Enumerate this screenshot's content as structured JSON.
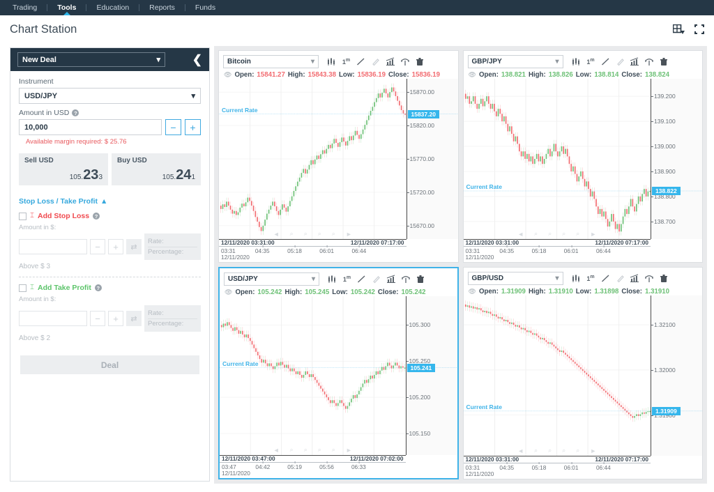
{
  "topnav": {
    "items": [
      {
        "label": "Trading",
        "active": false
      },
      {
        "label": "Tools",
        "active": true
      },
      {
        "label": "Education",
        "active": false
      },
      {
        "label": "Reports",
        "active": false
      },
      {
        "label": "Funds",
        "active": false
      }
    ]
  },
  "header": {
    "title": "Chart Station",
    "layout_icon": "grid-layout-icon",
    "fullscreen_icon": "fullscreen-icon"
  },
  "sidebar": {
    "panel_title": "New Deal",
    "collapse_icon": "chevron-left-icon",
    "instrument_label": "Instrument",
    "instrument_value": "USD/JPY",
    "amount_label": "Amount in USD",
    "amount_value": "10,000",
    "minus_label": "−",
    "plus_label": "+",
    "margin_note": "Available margin required: $ 25.76",
    "sell": {
      "label": "Sell USD",
      "int": "105.",
      "big": "23",
      "sub": "3"
    },
    "buy": {
      "label": "Buy USD",
      "int": "105.",
      "big": "24",
      "sub": "1"
    },
    "sltp_title": "Stop Loss / Take Profit",
    "sltp_caret": "▲",
    "stop_loss": {
      "label": "Add Stop Loss",
      "color": "#f04a4f",
      "amount_label": "Amount in $:",
      "amount_value": "",
      "rate_label": "Rate:",
      "percentage_label": "Percentage:",
      "above_note": "Above  $ 3"
    },
    "take_profit": {
      "label": "Add Take Profit",
      "color": "#5cc46a",
      "amount_label": "Amount in $:",
      "amount_value": "",
      "rate_label": "Rate:",
      "percentage_label": "Percentage:",
      "above_note": "Above  $ 2"
    },
    "deal_button": "Deal"
  },
  "chart_data": [
    {
      "id": "bitcoin",
      "type": "line",
      "title": "Bitcoin",
      "selected": false,
      "timeframe": "1m",
      "ohlc": {
        "open_label": "Open:",
        "open": "15841.27",
        "high_label": "High:",
        "high": "15843.38",
        "low_label": "Low:",
        "low": "15836.19",
        "close_label": "Close:",
        "close": "15836.19",
        "color": "#f26d72"
      },
      "current_rate_label": "Current Rate",
      "current_rate": "15837.20",
      "ylabel": "",
      "xlabel": "",
      "yticks": [
        "15870.00",
        "15820.00",
        "15770.00",
        "15720.00",
        "15670.00"
      ],
      "ylim": [
        15650,
        15890
      ],
      "xticks": [
        "03:31",
        "04:35",
        "05:18",
        "06:01",
        "06:44"
      ],
      "range_start": "12/11/2020 03:31:00",
      "range_end": "12/11/2020 07:17:00",
      "axis_date": "12/11/2020",
      "trend": "up",
      "values": [
        15700,
        15695,
        15702,
        15698,
        15706,
        15700,
        15694,
        15688,
        15692,
        15686,
        15690,
        15697,
        15703,
        15699,
        15705,
        15712,
        15707,
        15700,
        15692,
        15683,
        15676,
        15668,
        15662,
        15670,
        15679,
        15688,
        15694,
        15700,
        15706,
        15699,
        15692,
        15686,
        15694,
        15702,
        15697,
        15691,
        15699,
        15707,
        15714,
        15722,
        15729,
        15736,
        15742,
        15749,
        15755,
        15748,
        15754,
        15761,
        15768,
        15762,
        15769,
        15775,
        15770,
        15777,
        15783,
        15778,
        15785,
        15791,
        15786,
        15793,
        15800,
        15794,
        15788,
        15795,
        15802,
        15796,
        15790,
        15797,
        15804,
        15798,
        15805,
        15812,
        15806,
        15800,
        15807,
        15814,
        15821,
        15828,
        15835,
        15842,
        15848,
        15855,
        15861,
        15868,
        15862,
        15869,
        15875,
        15868,
        15862,
        15870,
        15877,
        15871,
        15864,
        15857,
        15850,
        15843,
        15838,
        15836
      ]
    },
    {
      "id": "gbpjpy",
      "type": "line",
      "title": "GBP/JPY",
      "selected": false,
      "timeframe": "1m",
      "ohlc": {
        "open_label": "Open:",
        "open": "138.821",
        "high_label": "High:",
        "high": "138.826",
        "low_label": "Low:",
        "low": "138.814",
        "close_label": "Close:",
        "close": "138.824",
        "color": "#6ec177"
      },
      "current_rate_label": "Current Rate",
      "current_rate": "138.822",
      "ylabel": "",
      "xlabel": "",
      "yticks": [
        "139.200",
        "139.100",
        "139.000",
        "138.900",
        "138.800",
        "138.700"
      ],
      "ylim": [
        138.63,
        139.27
      ],
      "xticks": [
        "03:31",
        "04:35",
        "05:18",
        "06:01",
        "06:44"
      ],
      "range_start": "12/11/2020 03:31:00",
      "range_end": "12/11/2020 07:17:00",
      "axis_date": "12/11/2020",
      "trend": "down",
      "values": [
        139.21,
        139.19,
        139.2,
        139.17,
        139.18,
        139.2,
        139.17,
        139.15,
        139.17,
        139.19,
        139.16,
        139.18,
        139.2,
        139.17,
        139.15,
        139.17,
        139.14,
        139.12,
        139.15,
        139.13,
        139.1,
        139.12,
        139.09,
        139.06,
        139.08,
        139.05,
        139.02,
        139.04,
        139.01,
        138.98,
        138.96,
        138.98,
        138.95,
        138.97,
        138.94,
        138.96,
        138.93,
        138.95,
        138.97,
        138.94,
        138.96,
        138.93,
        138.95,
        138.97,
        138.99,
        138.96,
        138.98,
        139.01,
        138.98,
        138.96,
        138.98,
        139.0,
        138.97,
        138.99,
        138.96,
        138.93,
        138.9,
        138.92,
        138.89,
        138.86,
        138.88,
        138.9,
        138.87,
        138.84,
        138.86,
        138.83,
        138.8,
        138.82,
        138.79,
        138.76,
        138.73,
        138.75,
        138.72,
        138.74,
        138.71,
        138.68,
        138.7,
        138.73,
        138.7,
        138.67,
        138.69,
        138.66,
        138.69,
        138.72,
        138.75,
        138.73,
        138.76,
        138.79,
        138.76,
        138.74,
        138.77,
        138.8,
        138.78,
        138.81,
        138.83,
        138.8,
        138.82,
        138.822
      ]
    },
    {
      "id": "usdjpy",
      "type": "line",
      "title": "USD/JPY",
      "selected": true,
      "timeframe": "1m",
      "ohlc": {
        "open_label": "Open:",
        "open": "105.242",
        "high_label": "High:",
        "high": "105.245",
        "low_label": "Low:",
        "low": "105.242",
        "close_label": "Close:",
        "close": "105.242",
        "color": "#6ec177"
      },
      "current_rate_label": "Current Rate",
      "current_rate": "105.241",
      "ylabel": "",
      "xlabel": "",
      "yticks": [
        "105.300",
        "105.250",
        "105.200",
        "105.150"
      ],
      "ylim": [
        105.12,
        105.34
      ],
      "xticks": [
        "03:47",
        "04:42",
        "05:19",
        "05:56",
        "06:33"
      ],
      "range_start": "12/11/2020 03:47:00",
      "range_end": "12/11/2020 07:02:00",
      "axis_date": "12/11/2020",
      "trend": "mixed",
      "values": [
        105.3,
        105.297,
        105.302,
        105.299,
        105.304,
        105.3,
        105.296,
        105.292,
        105.297,
        105.293,
        105.288,
        105.292,
        105.287,
        105.283,
        105.287,
        105.282,
        105.278,
        105.273,
        105.268,
        105.263,
        105.258,
        105.253,
        105.248,
        105.252,
        105.247,
        105.243,
        105.247,
        105.243,
        105.239,
        105.243,
        105.248,
        105.244,
        105.249,
        105.245,
        105.241,
        105.245,
        105.24,
        105.236,
        105.24,
        105.236,
        105.232,
        105.236,
        105.231,
        105.227,
        105.231,
        105.236,
        105.232,
        105.228,
        105.232,
        105.228,
        105.224,
        105.22,
        105.216,
        105.212,
        105.208,
        105.204,
        105.2,
        105.196,
        105.192,
        105.196,
        105.192,
        105.188,
        105.192,
        105.196,
        105.192,
        105.188,
        105.184,
        105.188,
        105.193,
        105.198,
        105.203,
        105.199,
        105.204,
        105.209,
        105.214,
        105.219,
        105.224,
        105.22,
        105.225,
        105.23,
        105.226,
        105.231,
        105.236,
        105.232,
        105.237,
        105.242,
        105.238,
        105.243,
        105.248,
        105.244,
        105.24,
        105.244,
        105.248,
        105.244,
        105.24,
        105.243,
        105.241,
        105.241
      ]
    },
    {
      "id": "gbpusd",
      "type": "line",
      "title": "GBP/USD",
      "selected": false,
      "timeframe": "1m",
      "ohlc": {
        "open_label": "Open:",
        "open": "1.31909",
        "high_label": "High:",
        "high": "1.31910",
        "low_label": "Low:",
        "low": "1.31898",
        "close_label": "Close:",
        "close": "1.31910",
        "color": "#6ec177"
      },
      "current_rate_label": "Current Rate",
      "current_rate": "1.31909",
      "ylabel": "",
      "xlabel": "",
      "yticks": [
        "1.32100",
        "1.32000",
        "1.31900"
      ],
      "ylim": [
        1.3181,
        1.32165
      ],
      "xticks": [
        "03:31",
        "04:35",
        "05:18",
        "06:01",
        "06:44"
      ],
      "range_start": "12/11/2020 03:31:00",
      "range_end": "12/11/2020 07:17:00",
      "axis_date": "12/11/2020",
      "trend": "down",
      "values": [
        1.32145,
        1.3214,
        1.32143,
        1.32138,
        1.32141,
        1.32136,
        1.32139,
        1.32134,
        1.32137,
        1.32132,
        1.32128,
        1.32131,
        1.32126,
        1.32129,
        1.32124,
        1.3212,
        1.32123,
        1.32118,
        1.32114,
        1.32117,
        1.32112,
        1.32108,
        1.32111,
        1.32106,
        1.32102,
        1.32105,
        1.321,
        1.32096,
        1.32099,
        1.32094,
        1.3209,
        1.32093,
        1.32088,
        1.32084,
        1.32087,
        1.32082,
        1.32078,
        1.32081,
        1.32076,
        1.32072,
        1.32068,
        1.32071,
        1.32066,
        1.32062,
        1.32058,
        1.32061,
        1.32056,
        1.32052,
        1.32048,
        1.32044,
        1.3204,
        1.32043,
        1.32038,
        1.32034,
        1.3203,
        1.32026,
        1.32022,
        1.32018,
        1.32014,
        1.3201,
        1.32006,
        1.32002,
        1.31998,
        1.31994,
        1.3199,
        1.31986,
        1.31982,
        1.31978,
        1.31974,
        1.3197,
        1.31966,
        1.31962,
        1.31958,
        1.31954,
        1.3195,
        1.31946,
        1.31942,
        1.31938,
        1.31934,
        1.3193,
        1.31926,
        1.31922,
        1.31918,
        1.31914,
        1.3191,
        1.31906,
        1.31902,
        1.31898,
        1.31894,
        1.31898,
        1.31902,
        1.31898,
        1.31902,
        1.31906,
        1.31903,
        1.31907,
        1.31909,
        1.31909
      ]
    }
  ],
  "chart_toolbar_icons": [
    "candlestick-chart-type-icon",
    "timeframe-1m-icon",
    "trendline-tool-icon",
    "pencil-tool-icon",
    "indicators-icon",
    "studies-icon",
    "delete-icon"
  ],
  "colors": {
    "accent": "#35b6ec",
    "navbar": "#253746",
    "up": "#6ec177",
    "down": "#f26d72",
    "selected_border": "#3fb3e8"
  }
}
